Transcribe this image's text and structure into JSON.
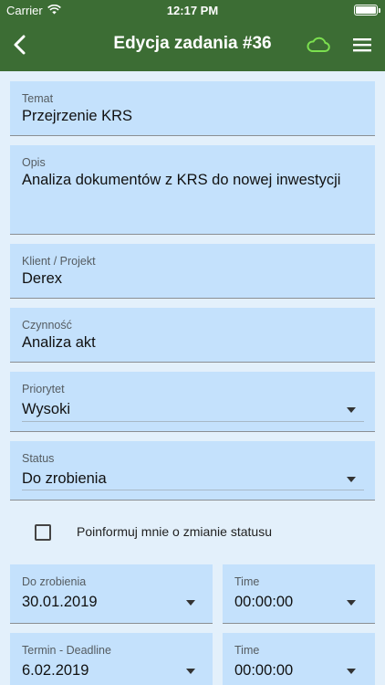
{
  "status_bar": {
    "carrier": "Carrier",
    "time": "12:17 PM"
  },
  "header": {
    "title": "Edycja zadania #36",
    "bg_color": "#3c6d34",
    "cloud_color": "#7ce04f"
  },
  "form": {
    "temat": {
      "label": "Temat",
      "value": "Przejrzenie KRS"
    },
    "opis": {
      "label": "Opis",
      "value": "Analiza dokumentów z KRS do nowej inwestycji"
    },
    "klient": {
      "label": "Klient / Projekt",
      "value": "Derex"
    },
    "czynnosc": {
      "label": "Czynność",
      "value": "Analiza akt"
    },
    "priorytet": {
      "label": "Priorytet",
      "value": "Wysoki"
    },
    "status": {
      "label": "Status",
      "value": "Do zrobienia"
    },
    "notify": {
      "label": "Poinformuj mnie o zmianie statusu",
      "checked": false
    },
    "do_zrobienia": {
      "label": "Do zrobienia",
      "value": "30.01.2019"
    },
    "do_zrobienia_time": {
      "label": "Time",
      "value": "00:00:00"
    },
    "deadline": {
      "label": "Termin - Deadline",
      "value": "6.02.2019"
    },
    "deadline_time": {
      "label": "Time",
      "value": "00:00:00"
    }
  }
}
